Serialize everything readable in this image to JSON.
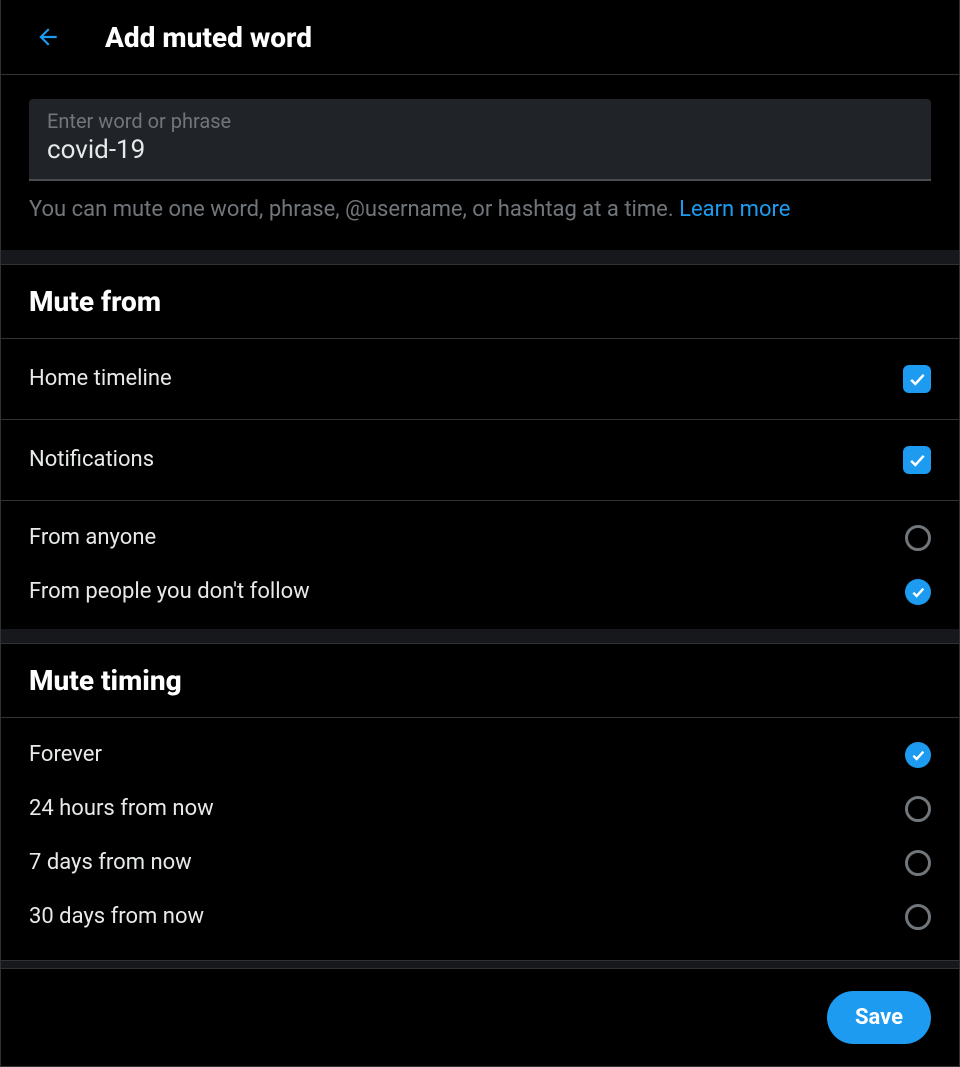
{
  "header": {
    "title": "Add muted word"
  },
  "input": {
    "label": "Enter word or phrase",
    "value": "covid-19"
  },
  "help": {
    "text": "You can mute one word, phrase, @username, or hashtag at a time. ",
    "link_label": "Learn more"
  },
  "mute_from": {
    "heading": "Mute from",
    "items": [
      {
        "label": "Home timeline",
        "checked": true
      },
      {
        "label": "Notifications",
        "checked": true
      }
    ],
    "radios": [
      {
        "label": "From anyone",
        "selected": false
      },
      {
        "label": "From people you don't follow",
        "selected": true
      }
    ]
  },
  "mute_timing": {
    "heading": "Mute timing",
    "radios": [
      {
        "label": "Forever",
        "selected": true
      },
      {
        "label": "24 hours from now",
        "selected": false
      },
      {
        "label": "7 days from now",
        "selected": false
      },
      {
        "label": "30 days from now",
        "selected": false
      }
    ]
  },
  "save": {
    "label": "Save"
  }
}
